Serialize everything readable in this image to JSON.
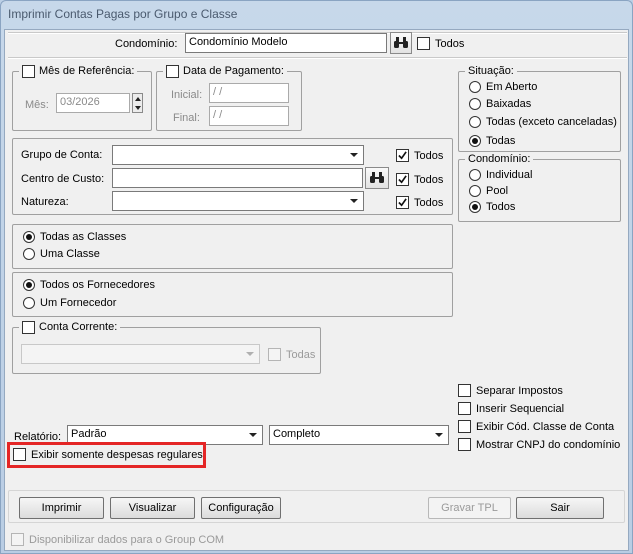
{
  "window": {
    "title": "Imprimir Contas Pagas por Grupo e Classe"
  },
  "condominio_row": {
    "label": "Condomínio:",
    "value": "Condomínio Modelo",
    "todos_label": "Todos"
  },
  "mes_ref": {
    "legend": "Mês de Referência:",
    "mes_label": "Mês:",
    "mes_value": "03/2026"
  },
  "data_pag": {
    "legend": "Data de Pagamento:",
    "inicial_label": "Inicial:",
    "inicial_value": " / /",
    "final_label": "Final:",
    "final_value": " / /"
  },
  "situacao": {
    "legend": "Situação:",
    "options": [
      "Em Aberto",
      "Baixadas",
      "Todas (exceto canceladas)",
      "Todas"
    ],
    "selected": "Todas"
  },
  "condominio_group": {
    "legend": "Condomínio:",
    "options": [
      "Individual",
      "Pool",
      "Todos"
    ],
    "selected": "Todos"
  },
  "filters": {
    "grupo_label": "Grupo de Conta:",
    "centro_label": "Centro de Custo:",
    "natureza_label": "Natureza:",
    "todos_label": "Todos"
  },
  "classes": {
    "options": [
      "Todas as Classes",
      "Uma Classe"
    ],
    "selected": "Todas as Classes"
  },
  "fornecedores": {
    "options": [
      "Todos os Fornecedores",
      "Um Fornecedor"
    ],
    "selected": "Todos os Fornecedores"
  },
  "conta_corrente": {
    "legend": "Conta Corrente:",
    "todas_label": "Todas"
  },
  "options_right": {
    "separar": "Separar Impostos",
    "inserir": "Inserir Sequencial",
    "exibir_cod": "Exibir Cód. Classe de Conta",
    "mostrar_cnpj": "Mostrar CNPJ do condomínio"
  },
  "relatorio": {
    "label": "Relatório:",
    "tipo": "Padrão",
    "formato": "Completo"
  },
  "exibir_regulares": "Exibir somente despesas regulares",
  "buttons": {
    "imprimir": "Imprimir",
    "visualizar": "Visualizar",
    "configuracao": "Configuração",
    "gravar": "Gravar TPL",
    "sair": "Sair"
  },
  "disponibilizar": "Disponibilizar dados para o Group COM",
  "colors": {
    "highlight": "#e42626",
    "window_frame": "#bcd0e6"
  }
}
